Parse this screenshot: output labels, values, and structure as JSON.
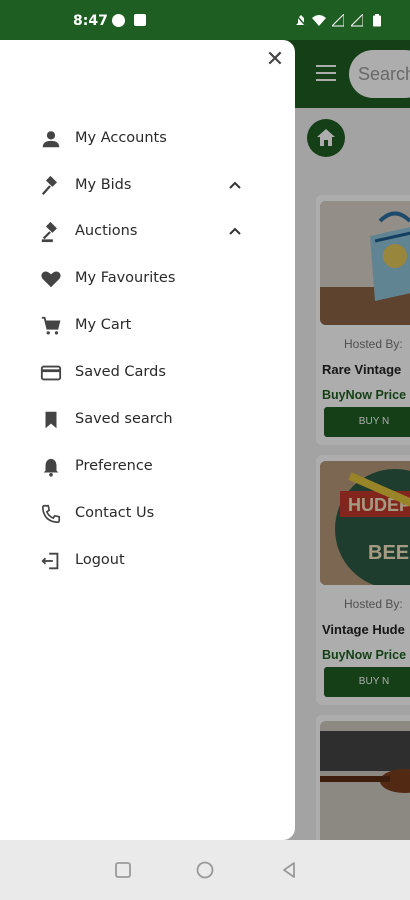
{
  "status_bar": {
    "time": "8:47"
  },
  "background_app": {
    "search": {
      "placeholder": "Search"
    },
    "cards": [
      {
        "hosted": "Hosted By:",
        "title": "Rare Vintage",
        "price": "BuyNow Price",
        "buy": "BUY N"
      },
      {
        "hosted": "Hosted By:",
        "title": "Vintage Hude",
        "price": "BuyNow Price",
        "buy": "BUY N"
      }
    ]
  },
  "drawer": {
    "items": [
      {
        "label": "My Accounts",
        "icon": "person-icon"
      },
      {
        "label": "My Bids",
        "icon": "gavel-icon",
        "chevron": "chevron-up-icon"
      },
      {
        "label": "Auctions",
        "icon": "gavel-icon",
        "chevron": "chevron-up-icon"
      },
      {
        "label": "My Favourites",
        "icon": "heart-icon"
      },
      {
        "label": "My Cart",
        "icon": "cart-icon"
      },
      {
        "label": "Saved Cards",
        "icon": "credit-card-icon"
      },
      {
        "label": "Saved search",
        "icon": "bookmark-icon"
      },
      {
        "label": "Preference",
        "icon": "bell-icon"
      },
      {
        "label": "Contact Us",
        "icon": "phone-icon"
      },
      {
        "label": "Logout",
        "icon": "logout-icon"
      }
    ]
  },
  "colors": {
    "brand": "#1f5e23",
    "accent_gold": "#b9a21c"
  }
}
